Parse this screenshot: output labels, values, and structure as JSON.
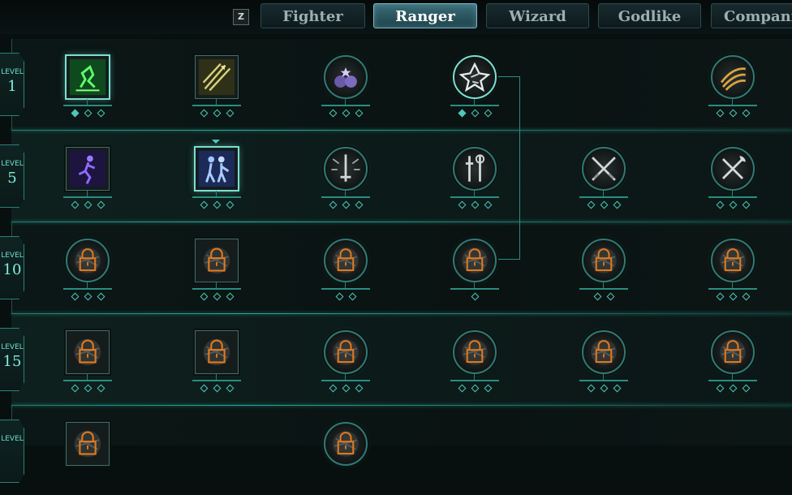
{
  "toolbar": {
    "hotkey": "Z"
  },
  "tabs": [
    {
      "label": "Fighter",
      "active": false
    },
    {
      "label": "Ranger",
      "active": true
    },
    {
      "label": "Wizard",
      "active": false
    },
    {
      "label": "Godlike",
      "active": false
    },
    {
      "label": "Companion",
      "active": false
    }
  ],
  "colors": {
    "accent": "#4fc7b8",
    "lock": "#e07a1f",
    "active_tab": "#3b6d78"
  },
  "levels": [
    {
      "word": "LEVEL",
      "number": "1"
    },
    {
      "word": "LEVEL",
      "number": "5"
    },
    {
      "word": "LEVEL",
      "number": "10"
    },
    {
      "word": "LEVEL",
      "number": "15"
    },
    {
      "word": "LEVEL",
      "number": ""
    }
  ],
  "rows": [
    {
      "abilities": [
        {
          "name": "green-rune-icon",
          "shape": "square",
          "selected": true,
          "locked": false,
          "pips": 3,
          "filled": 1
        },
        {
          "name": "triple-arrow-icon",
          "shape": "square",
          "selected": false,
          "locked": false,
          "pips": 3,
          "filled": 0
        },
        {
          "name": "potion-bombs-icon",
          "shape": "circle",
          "selected": false,
          "locked": false,
          "pips": 3,
          "filled": 0
        },
        {
          "name": "shattered-star-icon",
          "shape": "circle",
          "selected": true,
          "locked": false,
          "pips": 3,
          "filled": 1
        },
        null,
        {
          "name": "golden-claw-icon",
          "shape": "circle",
          "selected": false,
          "locked": false,
          "pips": 3,
          "filled": 0
        }
      ]
    },
    {
      "abilities": [
        {
          "name": "purple-runner-icon",
          "shape": "square",
          "selected": false,
          "locked": false,
          "pips": 3,
          "filled": 0
        },
        {
          "name": "twin-figures-icon",
          "shape": "square",
          "selected": true,
          "locked": false,
          "pips": 3,
          "filled": 0,
          "marker": true
        },
        {
          "name": "sword-burst-icon",
          "shape": "circle",
          "selected": false,
          "locked": false,
          "pips": 3,
          "filled": 0
        },
        {
          "name": "weapon-pair-icon",
          "shape": "circle",
          "selected": false,
          "locked": false,
          "pips": 3,
          "filled": 0
        },
        {
          "name": "crossed-blades-icon",
          "shape": "circle",
          "selected": false,
          "locked": false,
          "pips": 3,
          "filled": 0
        },
        {
          "name": "crossed-axe-icon",
          "shape": "circle",
          "selected": false,
          "locked": false,
          "pips": 3,
          "filled": 0
        }
      ]
    },
    {
      "abilities": [
        {
          "name": "locked-talent-icon",
          "shape": "circle",
          "selected": false,
          "locked": true,
          "pips": 3,
          "filled": 0
        },
        {
          "name": "locked-talent-icon",
          "shape": "square",
          "selected": false,
          "locked": true,
          "pips": 3,
          "filled": 0
        },
        {
          "name": "locked-talent-icon",
          "shape": "circle",
          "selected": false,
          "locked": true,
          "pips": 2,
          "filled": 0
        },
        {
          "name": "locked-talent-icon",
          "shape": "circle",
          "selected": false,
          "locked": true,
          "pips": 1,
          "filled": 0
        },
        {
          "name": "locked-talent-icon",
          "shape": "circle",
          "selected": false,
          "locked": true,
          "pips": 2,
          "filled": 0
        },
        {
          "name": "locked-talent-icon",
          "shape": "circle",
          "selected": false,
          "locked": true,
          "pips": 3,
          "filled": 0
        }
      ]
    },
    {
      "abilities": [
        {
          "name": "locked-talent-icon",
          "shape": "square",
          "selected": false,
          "locked": true,
          "pips": 3,
          "filled": 0
        },
        {
          "name": "locked-talent-icon",
          "shape": "square",
          "selected": false,
          "locked": true,
          "pips": 3,
          "filled": 0
        },
        {
          "name": "locked-talent-icon",
          "shape": "circle",
          "selected": false,
          "locked": true,
          "pips": 3,
          "filled": 0
        },
        {
          "name": "locked-talent-icon",
          "shape": "circle",
          "selected": false,
          "locked": true,
          "pips": 3,
          "filled": 0
        },
        {
          "name": "locked-talent-icon",
          "shape": "circle",
          "selected": false,
          "locked": true,
          "pips": 3,
          "filled": 0
        },
        {
          "name": "locked-talent-icon",
          "shape": "circle",
          "selected": false,
          "locked": true,
          "pips": 3,
          "filled": 0
        }
      ]
    },
    {
      "abilities": [
        {
          "name": "locked-talent-icon",
          "shape": "square",
          "selected": false,
          "locked": true,
          "pips": 0,
          "filled": 0
        },
        null,
        {
          "name": "locked-talent-icon",
          "shape": "circle",
          "selected": false,
          "locked": true,
          "pips": 0,
          "filled": 0
        },
        null,
        null,
        null
      ]
    }
  ]
}
